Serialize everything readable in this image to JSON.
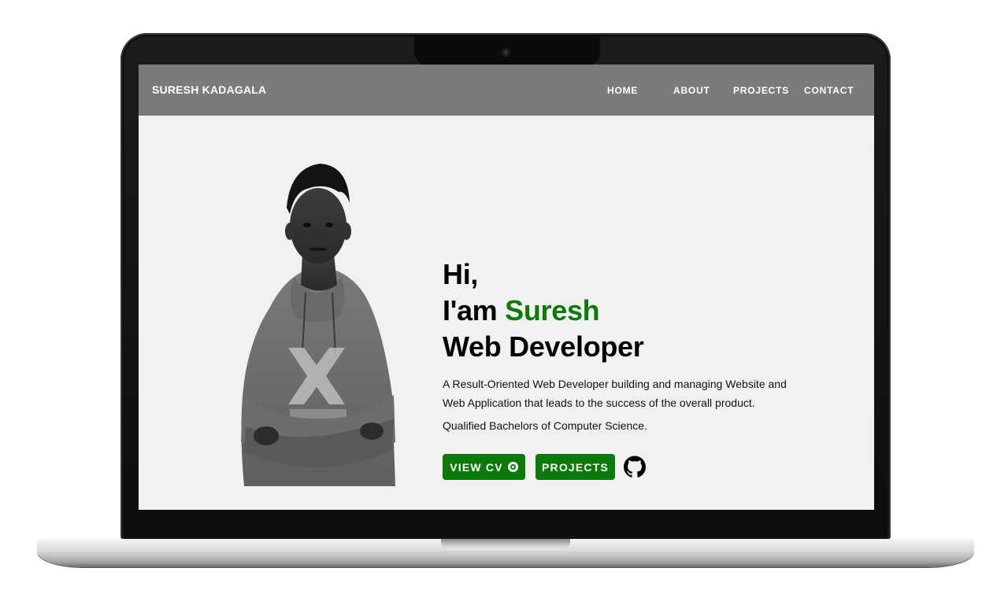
{
  "navbar": {
    "brand": "SURESH KADAGALA",
    "links": [
      "HOME",
      "ABOUT",
      "PROJECTS",
      "CONTACT"
    ]
  },
  "hero": {
    "greeting": "Hi,",
    "intro_prefix": "I'am ",
    "name": "Suresh",
    "role": "Web Developer",
    "description": "A Result-Oriented Web Developer building and managing Website and Web Application that leads to the success of the overall product.",
    "qualification": "Qualified Bachelors of Computer Science.",
    "view_cv_label": "VIEW CV",
    "view_cv_icon": "eye-icon",
    "projects_label": "PROJECTS",
    "github_icon": "github-icon"
  },
  "colors": {
    "accent": "#0b7a0b",
    "navbar_bg": "#7b7b7b",
    "page_bg": "#f1f1f1"
  }
}
